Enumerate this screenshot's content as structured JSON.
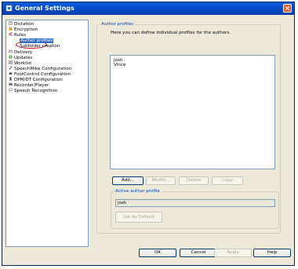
{
  "window": {
    "title": "General Settings"
  },
  "tree": {
    "items": [
      {
        "label": "Dictation",
        "icon": "dictation-icon"
      },
      {
        "label": "Encryption",
        "icon": "encryption-icon"
      },
      {
        "label": "Rules",
        "icon": "rules-icon"
      },
      {
        "label": "Author profiles",
        "icon": "",
        "selected": true
      },
      {
        "label": "Subfolder creation",
        "icon": ""
      },
      {
        "label": "Delivery",
        "icon": "delivery-icon"
      },
      {
        "label": "Updates",
        "icon": "updates-icon"
      },
      {
        "label": "Worklist",
        "icon": "worklist-icon"
      },
      {
        "label": "SpeechMike Configuration",
        "icon": "speechmike-icon"
      },
      {
        "label": "FootControl Configuration",
        "icon": "footcontrol-icon"
      },
      {
        "label": "DPM/DT Configuration",
        "icon": "dpm-icon"
      },
      {
        "label": "Recorder/Player",
        "icon": "recorder-icon"
      },
      {
        "label": "Speech Recognition",
        "icon": "speech-recognition-icon"
      }
    ]
  },
  "author_profiles": {
    "group_label": "Author profiles",
    "description": "Here you can define individual profiles for the authors.",
    "list": [
      "josh",
      "Vince"
    ],
    "buttons": {
      "add": "Add...",
      "modify": "Modify...",
      "delete": "Delete",
      "copy": "Copy"
    }
  },
  "active_profile": {
    "group_label": "Active author profile",
    "value": "josh",
    "set_default": "Set As Default"
  },
  "footer": {
    "ok": "OK",
    "cancel": "Cancel",
    "apply": "Apply",
    "help": "Help"
  },
  "colors": {
    "titlebar": "#0346c6",
    "selection": "#316ac5",
    "highlight_circle": "#cc0000"
  }
}
